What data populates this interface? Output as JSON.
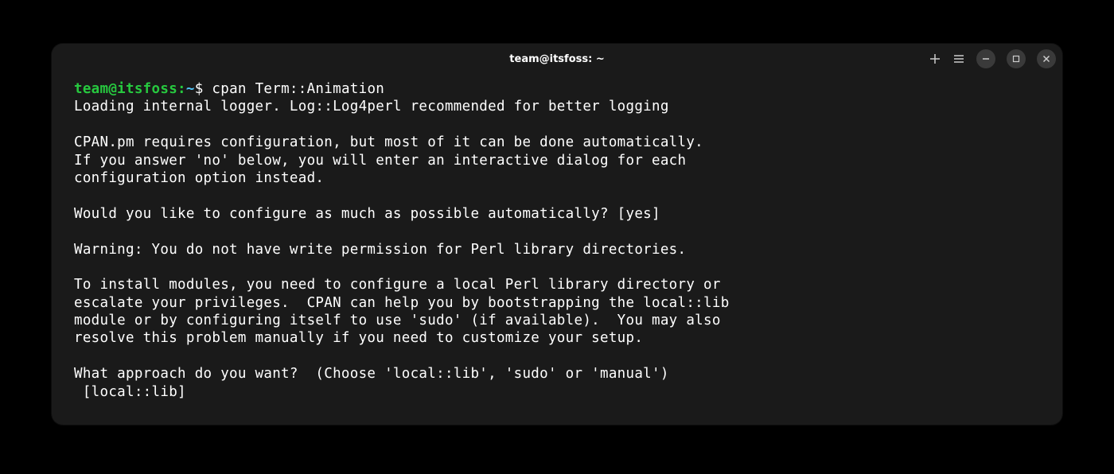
{
  "window": {
    "title": "team@itsfoss: ~"
  },
  "prompt": {
    "user_host": "team@itsfoss",
    "separator": ":",
    "path": "~",
    "symbol": "$"
  },
  "command": "cpan Term::Animation",
  "output": {
    "line1": "Loading internal logger. Log::Log4perl recommended for better logging",
    "line2": "",
    "line3": "CPAN.pm requires configuration, but most of it can be done automatically.",
    "line4": "If you answer 'no' below, you will enter an interactive dialog for each",
    "line5": "configuration option instead.",
    "line6": "",
    "line7": "Would you like to configure as much as possible automatically? [yes]",
    "line8": "",
    "line9": "Warning: You do not have write permission for Perl library directories.",
    "line10": "",
    "line11": "To install modules, you need to configure a local Perl library directory or",
    "line12": "escalate your privileges.  CPAN can help you by bootstrapping the local::lib",
    "line13": "module or by configuring itself to use 'sudo' (if available).  You may also",
    "line14": "resolve this problem manually if you need to customize your setup.",
    "line15": "",
    "line16": "What approach do you want?  (Choose 'local::lib', 'sudo' or 'manual')",
    "line17": " [local::lib]"
  }
}
